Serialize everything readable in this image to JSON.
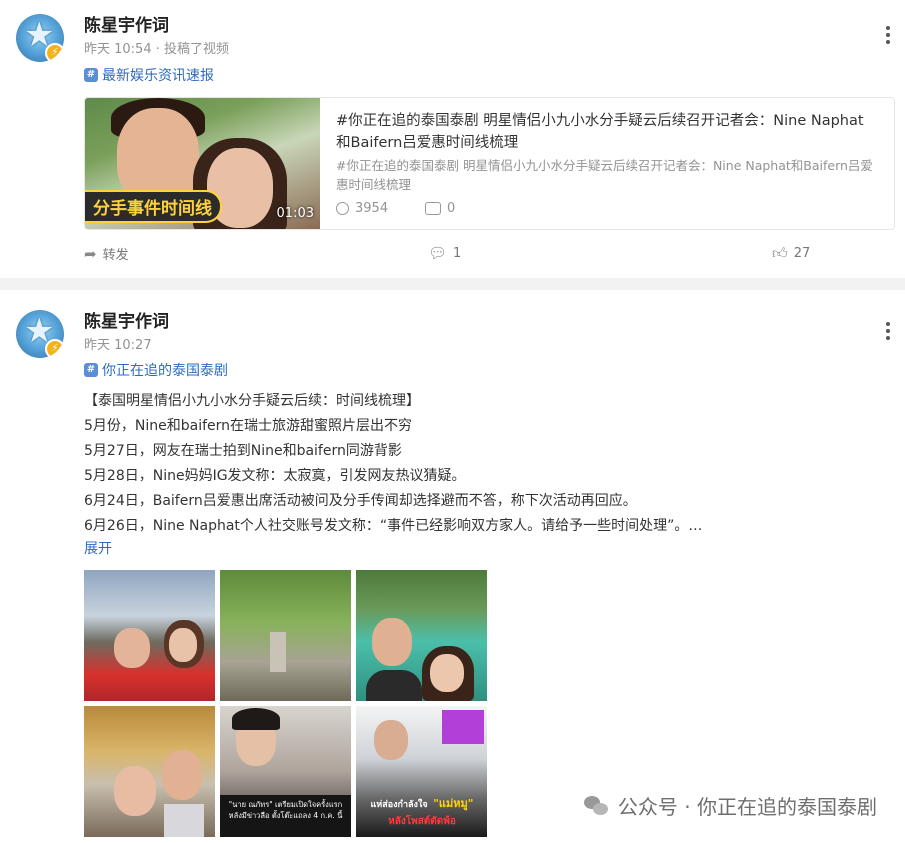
{
  "post1": {
    "author": "陈星宇作词",
    "time": "昨天 10:54",
    "action": "投稿了视频",
    "topic": "最新娱乐资讯速报",
    "card": {
      "tag": "分手事件时间线",
      "duration": "01:03",
      "title": "#你正在追的泰国泰剧 明星情侣小九小水分手疑云后续召开记者会：Nine Naphat和Baifern吕爱惠时间线梳理",
      "desc": "#你正在追的泰国泰剧 明星情侣小九小水分手疑云后续召开记者会：Nine Naphat和Baifern吕爱惠时间线梳理",
      "plays": "3954",
      "comments": "0"
    },
    "actions": {
      "repost": "转发",
      "comment_count": "1",
      "like_count": "27"
    }
  },
  "post2": {
    "author": "陈星宇作词",
    "time": "昨天 10:27",
    "topic": "你正在追的泰国泰剧",
    "lines": [
      "【泰国明星情侣小九小水分手疑云后续：时间线梳理】",
      "5月份，Nine和baifern在瑞士旅游甜蜜照片层出不穷",
      "5月27日，网友在瑞士拍到Nine和baifern同游背影",
      "5月28日，Nine妈妈IG发文称：太寂寞，引发网友热议猜疑。",
      "6月24日，Baifern吕爱惠出席活动被问及分手传闻却选择避而不答，称下次活动再回应。",
      "6月26日，Nine Naphat个人社交账号发文称：“事件已经影响双方家人。请给予一些时间处理”。…"
    ],
    "expand": "展开",
    "photo_texts": {
      "p5": "\"นาย ณภัทร\" เตรียมเปิดใจครั้งแรก หลังมีข่าวลือ ตั้งโต๊ะแถลง 4 ก.ค. นี้",
      "p6_a": "แห่ส่องกำลังใจ",
      "p6_b": "\"แม่หมู\"",
      "p6_c": "หลังโพสต์ตัดพ้อ"
    }
  },
  "watermark": "公众号 · 你正在追的泰国泰剧",
  "colors": {
    "link": "#2f6bbd",
    "muted": "#939393",
    "badge": "#f6b21a",
    "separator": "#f2f2f2"
  }
}
